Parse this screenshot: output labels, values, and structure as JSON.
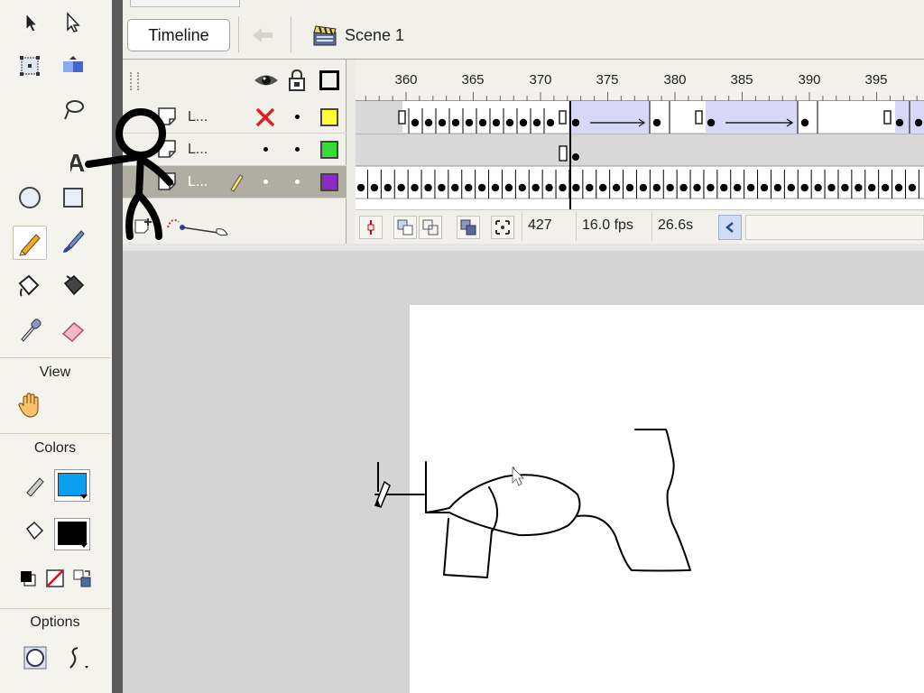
{
  "edit_bar": {
    "timeline_button": "Timeline",
    "scene_label": "Scene 1"
  },
  "tools": {
    "view_title": "View",
    "colors_title": "Colors",
    "options_title": "Options",
    "stroke_color": "#000000",
    "fill_color": "#0aa0f0"
  },
  "layers": [
    {
      "name": "L...",
      "color": "#ffff33",
      "visibility": "hidden-x"
    },
    {
      "name": "L...",
      "color": "#33dd33",
      "visibility": "dot"
    },
    {
      "name": "L...",
      "color": "#8a2bc8",
      "visibility": "dot",
      "active": true
    }
  ],
  "timeline": {
    "ruler_labels": [
      "360",
      "365",
      "370",
      "375",
      "380",
      "385",
      "390",
      "395"
    ],
    "current_frame": "427",
    "frame_rate": "16.0 fps",
    "elapsed_time": "26.6s"
  },
  "overlay": {
    "stickman_letter": "A"
  }
}
